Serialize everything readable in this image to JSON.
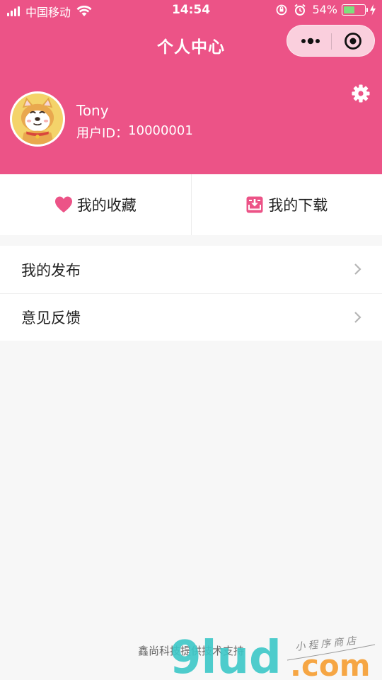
{
  "status_bar": {
    "carrier": "中国移动",
    "time": "14:54",
    "battery_percent": "54%",
    "battery_level": 0.54,
    "icons": [
      "signal-icon",
      "wifi-icon",
      "orientation-lock-icon",
      "alarm-icon",
      "battery-icon",
      "charging-icon"
    ]
  },
  "nav": {
    "title": "个人中心",
    "capsule": {
      "more_icon": "more-dots-icon",
      "close_icon": "target-circle-icon"
    }
  },
  "profile": {
    "name": "Tony",
    "id_label": "用户ID：",
    "id_value": "10000001",
    "settings_icon": "gear-icon",
    "avatar_icon": "shiba-dog-avatar"
  },
  "actions": [
    {
      "label": "我的收藏",
      "icon": "heart-icon"
    },
    {
      "label": "我的下载",
      "icon": "download-icon"
    }
  ],
  "menu": [
    {
      "label": "我的发布"
    },
    {
      "label": "意见反馈"
    }
  ],
  "footer": {
    "support_text": "鑫尚科技提供技术支持",
    "watermark": {
      "logo": "9lud",
      "domain": ".com",
      "tagline": "小程序商店"
    }
  },
  "colors": {
    "header_bg": "#ec5387",
    "accent": "#ec5387",
    "page_bg": "#f7f7f7",
    "battery_fill": "#7de07d"
  }
}
